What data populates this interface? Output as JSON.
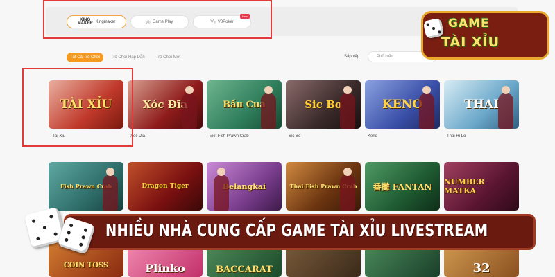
{
  "providers": [
    {
      "name": "Kingmaker",
      "icon": "KING MAKER",
      "active": true
    },
    {
      "name": "Game Play",
      "icon": "gameplay-icon",
      "active": false
    },
    {
      "name": "V8Poker",
      "icon": "v8-icon",
      "active": false,
      "badge": "New"
    }
  ],
  "tabs": [
    {
      "label": "Tất Cả Trò Chơi",
      "active": true
    },
    {
      "label": "Trò Chơi Hấp Dẫn",
      "active": false
    },
    {
      "label": "Trò Chơi Mới",
      "active": false
    }
  ],
  "sort": {
    "label": "Sắp xếp",
    "value": "Phổ biến"
  },
  "games_row1": [
    {
      "title": "TÀI XỈU",
      "caption": "Tai Xiu",
      "color": "#c0392b"
    },
    {
      "title": "Xóc Đĩa",
      "caption": "Xoc Dia",
      "color": "#8e1b1b"
    },
    {
      "title": "Bầu Cua",
      "caption": "Viet Fish Prawn Crab",
      "color": "#2e7d5b"
    },
    {
      "title": "Sic Bo",
      "caption": "Sic Bo",
      "color": "#3a2a2a"
    },
    {
      "title": "KENO",
      "caption": "Keno",
      "color": "#3a4fa8"
    },
    {
      "title": "THAI",
      "caption": "Thai Hi Lo",
      "color": "#6aa7c9"
    }
  ],
  "games_row2": [
    {
      "title": "Fish Prawn Crab",
      "color": "#2f6e6a"
    },
    {
      "title": "Dragon Tiger",
      "color": "#7a1010"
    },
    {
      "title": "Belangkai",
      "color": "#7b3e8f"
    },
    {
      "title": "Thai Fish Prawn Crab",
      "color": "#6b3410"
    },
    {
      "title": "番攤 FANTAN",
      "color": "#1f5a32"
    },
    {
      "title": "NUMBER MATKA",
      "color": "#5a1530"
    }
  ],
  "games_row3": [
    {
      "title": "COIN TOSS",
      "color": "#8a2a10"
    },
    {
      "title": "Plinko",
      "color": "#c2306a"
    },
    {
      "title": "BACCARAT",
      "color": "#1b4a2a"
    },
    {
      "title": "",
      "color": "#3a2a1a"
    },
    {
      "title": "",
      "color": "#1a3f2a"
    },
    {
      "title": "32",
      "color": "#8a5020"
    }
  ],
  "banner": {
    "text": "NHIỀU NHÀ CUNG CẤP GAME TÀI XỈU LIVESTREAM"
  },
  "logo": {
    "line1": "GAME",
    "line2": "TÀI XỈU"
  }
}
